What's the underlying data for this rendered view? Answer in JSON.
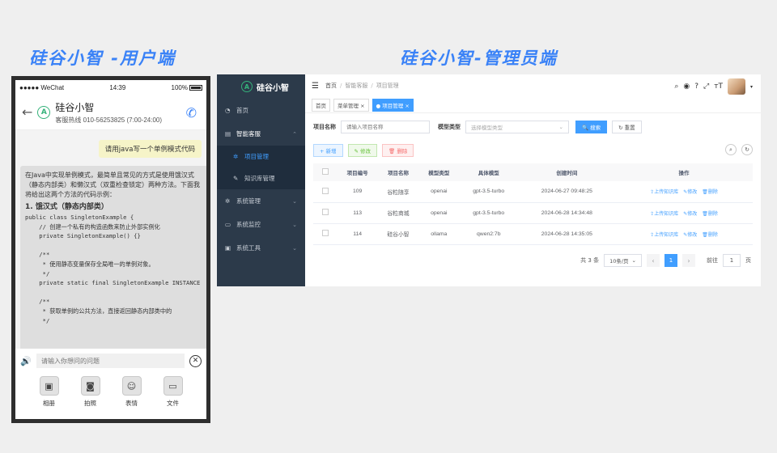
{
  "titles": {
    "left": "硅谷小智 -用户端",
    "right": "硅谷小智-管理员端"
  },
  "phone": {
    "status": {
      "carrier": "●●●●● WeChat",
      "time": "14:39",
      "battery": "100%"
    },
    "header": {
      "title": "硅谷小智",
      "hotline": "客服热线 010-56253825 (7:00-24:00)"
    },
    "user_message": "请用java写一个单例模式代码",
    "bot_intro": "在Java中实现单例模式，最简单且常见的方式是使用饿汉式（静态内部类）和懒汉式（双重检查锁定）两种方法。下面我将给出这两个方法的代码示例：",
    "bot_heading": "1. 饿汉式（静态内部类）",
    "bot_code": "public class SingletonExample {\n    // 创建一个私有的构造函数来防止外部实例化\n    private SingletonExample() {}\n\n    /**\n     * 使用静态变量保存全局唯一的单例对象。\n     */\n    private static final SingletonExample INSTANCE\n\n    /**\n     * 获取单例的公共方法，直接返回静态内部类中的\n     */",
    "input_placeholder": "请输入你想问的问题",
    "tools": [
      {
        "icon": "image-icon",
        "glyph": "▣",
        "label": "相册"
      },
      {
        "icon": "camera-icon",
        "glyph": "◙",
        "label": "拍照"
      },
      {
        "icon": "smile-icon",
        "glyph": "☺",
        "label": "表情"
      },
      {
        "icon": "folder-icon",
        "glyph": "▭",
        "label": "文件"
      }
    ]
  },
  "admin": {
    "logo": "硅谷小智",
    "sidebar": [
      {
        "label": "首页",
        "icon": "dashboard-icon",
        "glyph": "◔",
        "chevron": ""
      },
      {
        "label": "智能客服",
        "icon": "chat-icon",
        "glyph": "▤",
        "chevron": "⌃"
      },
      {
        "label": "项目管理",
        "icon": "gear-icon",
        "glyph": "✲",
        "chevron": "",
        "sub": true,
        "active": true
      },
      {
        "label": "知识库管理",
        "icon": "edit-icon",
        "glyph": "✎",
        "chevron": "",
        "sub": true
      },
      {
        "label": "系统管理",
        "icon": "settings-icon",
        "glyph": "✲",
        "chevron": "⌄"
      },
      {
        "label": "系统监控",
        "icon": "monitor-icon",
        "glyph": "▭",
        "chevron": "⌄"
      },
      {
        "label": "系统工具",
        "icon": "toolbox-icon",
        "glyph": "▣",
        "chevron": "⌄"
      }
    ],
    "breadcrumb": [
      "首页",
      "智能客服",
      "项目管理"
    ],
    "tabs": [
      {
        "label": "首页",
        "active": false
      },
      {
        "label": "菜单管理 ×",
        "active": false
      },
      {
        "label": "● 项目管理 ×",
        "active": true
      }
    ],
    "search": {
      "name_label": "项目名称",
      "name_placeholder": "请输入项目名称",
      "type_label": "模型类型",
      "type_placeholder": "选择模型类型",
      "search_btn": "🔍 搜索",
      "reset_btn": "↻ 重置"
    },
    "actions": {
      "add": "+ 新增",
      "edit": "✎ 修改",
      "delete": "🗑 删除"
    },
    "table": {
      "headers": [
        "项目编号",
        "项目名称",
        "模型类型",
        "具体模型",
        "创建时间",
        "操作"
      ],
      "rows": [
        [
          "109",
          "谷粒随享",
          "openai",
          "gpt-3.5-turbo",
          "2024-06-27 09:48:25"
        ],
        [
          "113",
          "谷粒商城",
          "openai",
          "gpt-3.5-turbo",
          "2024-06-28 14:34:48"
        ],
        [
          "114",
          "硅谷小智",
          "ollama",
          "qwen2:7b",
          "2024-06-28 14:35:05"
        ]
      ],
      "ops": [
        "⇪上传知识库",
        "✎修改",
        "🗑删除"
      ]
    },
    "pager": {
      "total": "共 3 条",
      "size": "10条/页",
      "current": "1",
      "goto_label": "前往",
      "goto_value": "1",
      "page_unit": "页"
    }
  }
}
